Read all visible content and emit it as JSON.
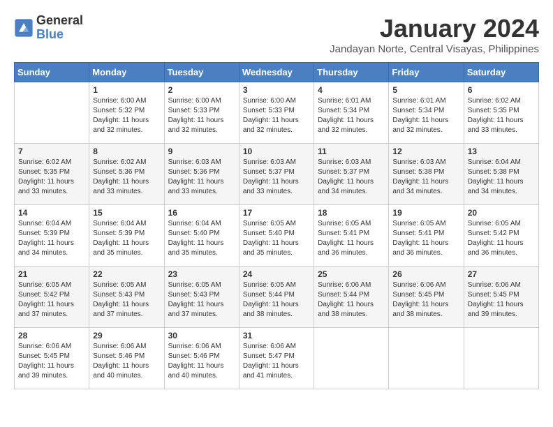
{
  "header": {
    "logo_line1": "General",
    "logo_line2": "Blue",
    "month_title": "January 2024",
    "location": "Jandayan Norte, Central Visayas, Philippines"
  },
  "calendar": {
    "days_of_week": [
      "Sunday",
      "Monday",
      "Tuesday",
      "Wednesday",
      "Thursday",
      "Friday",
      "Saturday"
    ],
    "weeks": [
      [
        {
          "day": "",
          "sunrise": "",
          "sunset": "",
          "daylight": ""
        },
        {
          "day": "1",
          "sunrise": "Sunrise: 6:00 AM",
          "sunset": "Sunset: 5:32 PM",
          "daylight": "Daylight: 11 hours and 32 minutes."
        },
        {
          "day": "2",
          "sunrise": "Sunrise: 6:00 AM",
          "sunset": "Sunset: 5:33 PM",
          "daylight": "Daylight: 11 hours and 32 minutes."
        },
        {
          "day": "3",
          "sunrise": "Sunrise: 6:00 AM",
          "sunset": "Sunset: 5:33 PM",
          "daylight": "Daylight: 11 hours and 32 minutes."
        },
        {
          "day": "4",
          "sunrise": "Sunrise: 6:01 AM",
          "sunset": "Sunset: 5:34 PM",
          "daylight": "Daylight: 11 hours and 32 minutes."
        },
        {
          "day": "5",
          "sunrise": "Sunrise: 6:01 AM",
          "sunset": "Sunset: 5:34 PM",
          "daylight": "Daylight: 11 hours and 32 minutes."
        },
        {
          "day": "6",
          "sunrise": "Sunrise: 6:02 AM",
          "sunset": "Sunset: 5:35 PM",
          "daylight": "Daylight: 11 hours and 33 minutes."
        }
      ],
      [
        {
          "day": "7",
          "sunrise": "Sunrise: 6:02 AM",
          "sunset": "Sunset: 5:35 PM",
          "daylight": "Daylight: 11 hours and 33 minutes."
        },
        {
          "day": "8",
          "sunrise": "Sunrise: 6:02 AM",
          "sunset": "Sunset: 5:36 PM",
          "daylight": "Daylight: 11 hours and 33 minutes."
        },
        {
          "day": "9",
          "sunrise": "Sunrise: 6:03 AM",
          "sunset": "Sunset: 5:36 PM",
          "daylight": "Daylight: 11 hours and 33 minutes."
        },
        {
          "day": "10",
          "sunrise": "Sunrise: 6:03 AM",
          "sunset": "Sunset: 5:37 PM",
          "daylight": "Daylight: 11 hours and 33 minutes."
        },
        {
          "day": "11",
          "sunrise": "Sunrise: 6:03 AM",
          "sunset": "Sunset: 5:37 PM",
          "daylight": "Daylight: 11 hours and 34 minutes."
        },
        {
          "day": "12",
          "sunrise": "Sunrise: 6:03 AM",
          "sunset": "Sunset: 5:38 PM",
          "daylight": "Daylight: 11 hours and 34 minutes."
        },
        {
          "day": "13",
          "sunrise": "Sunrise: 6:04 AM",
          "sunset": "Sunset: 5:38 PM",
          "daylight": "Daylight: 11 hours and 34 minutes."
        }
      ],
      [
        {
          "day": "14",
          "sunrise": "Sunrise: 6:04 AM",
          "sunset": "Sunset: 5:39 PM",
          "daylight": "Daylight: 11 hours and 34 minutes."
        },
        {
          "day": "15",
          "sunrise": "Sunrise: 6:04 AM",
          "sunset": "Sunset: 5:39 PM",
          "daylight": "Daylight: 11 hours and 35 minutes."
        },
        {
          "day": "16",
          "sunrise": "Sunrise: 6:04 AM",
          "sunset": "Sunset: 5:40 PM",
          "daylight": "Daylight: 11 hours and 35 minutes."
        },
        {
          "day": "17",
          "sunrise": "Sunrise: 6:05 AM",
          "sunset": "Sunset: 5:40 PM",
          "daylight": "Daylight: 11 hours and 35 minutes."
        },
        {
          "day": "18",
          "sunrise": "Sunrise: 6:05 AM",
          "sunset": "Sunset: 5:41 PM",
          "daylight": "Daylight: 11 hours and 36 minutes."
        },
        {
          "day": "19",
          "sunrise": "Sunrise: 6:05 AM",
          "sunset": "Sunset: 5:41 PM",
          "daylight": "Daylight: 11 hours and 36 minutes."
        },
        {
          "day": "20",
          "sunrise": "Sunrise: 6:05 AM",
          "sunset": "Sunset: 5:42 PM",
          "daylight": "Daylight: 11 hours and 36 minutes."
        }
      ],
      [
        {
          "day": "21",
          "sunrise": "Sunrise: 6:05 AM",
          "sunset": "Sunset: 5:42 PM",
          "daylight": "Daylight: 11 hours and 37 minutes."
        },
        {
          "day": "22",
          "sunrise": "Sunrise: 6:05 AM",
          "sunset": "Sunset: 5:43 PM",
          "daylight": "Daylight: 11 hours and 37 minutes."
        },
        {
          "day": "23",
          "sunrise": "Sunrise: 6:05 AM",
          "sunset": "Sunset: 5:43 PM",
          "daylight": "Daylight: 11 hours and 37 minutes."
        },
        {
          "day": "24",
          "sunrise": "Sunrise: 6:05 AM",
          "sunset": "Sunset: 5:44 PM",
          "daylight": "Daylight: 11 hours and 38 minutes."
        },
        {
          "day": "25",
          "sunrise": "Sunrise: 6:06 AM",
          "sunset": "Sunset: 5:44 PM",
          "daylight": "Daylight: 11 hours and 38 minutes."
        },
        {
          "day": "26",
          "sunrise": "Sunrise: 6:06 AM",
          "sunset": "Sunset: 5:45 PM",
          "daylight": "Daylight: 11 hours and 38 minutes."
        },
        {
          "day": "27",
          "sunrise": "Sunrise: 6:06 AM",
          "sunset": "Sunset: 5:45 PM",
          "daylight": "Daylight: 11 hours and 39 minutes."
        }
      ],
      [
        {
          "day": "28",
          "sunrise": "Sunrise: 6:06 AM",
          "sunset": "Sunset: 5:45 PM",
          "daylight": "Daylight: 11 hours and 39 minutes."
        },
        {
          "day": "29",
          "sunrise": "Sunrise: 6:06 AM",
          "sunset": "Sunset: 5:46 PM",
          "daylight": "Daylight: 11 hours and 40 minutes."
        },
        {
          "day": "30",
          "sunrise": "Sunrise: 6:06 AM",
          "sunset": "Sunset: 5:46 PM",
          "daylight": "Daylight: 11 hours and 40 minutes."
        },
        {
          "day": "31",
          "sunrise": "Sunrise: 6:06 AM",
          "sunset": "Sunset: 5:47 PM",
          "daylight": "Daylight: 11 hours and 41 minutes."
        },
        {
          "day": "",
          "sunrise": "",
          "sunset": "",
          "daylight": ""
        },
        {
          "day": "",
          "sunrise": "",
          "sunset": "",
          "daylight": ""
        },
        {
          "day": "",
          "sunrise": "",
          "sunset": "",
          "daylight": ""
        }
      ]
    ]
  }
}
